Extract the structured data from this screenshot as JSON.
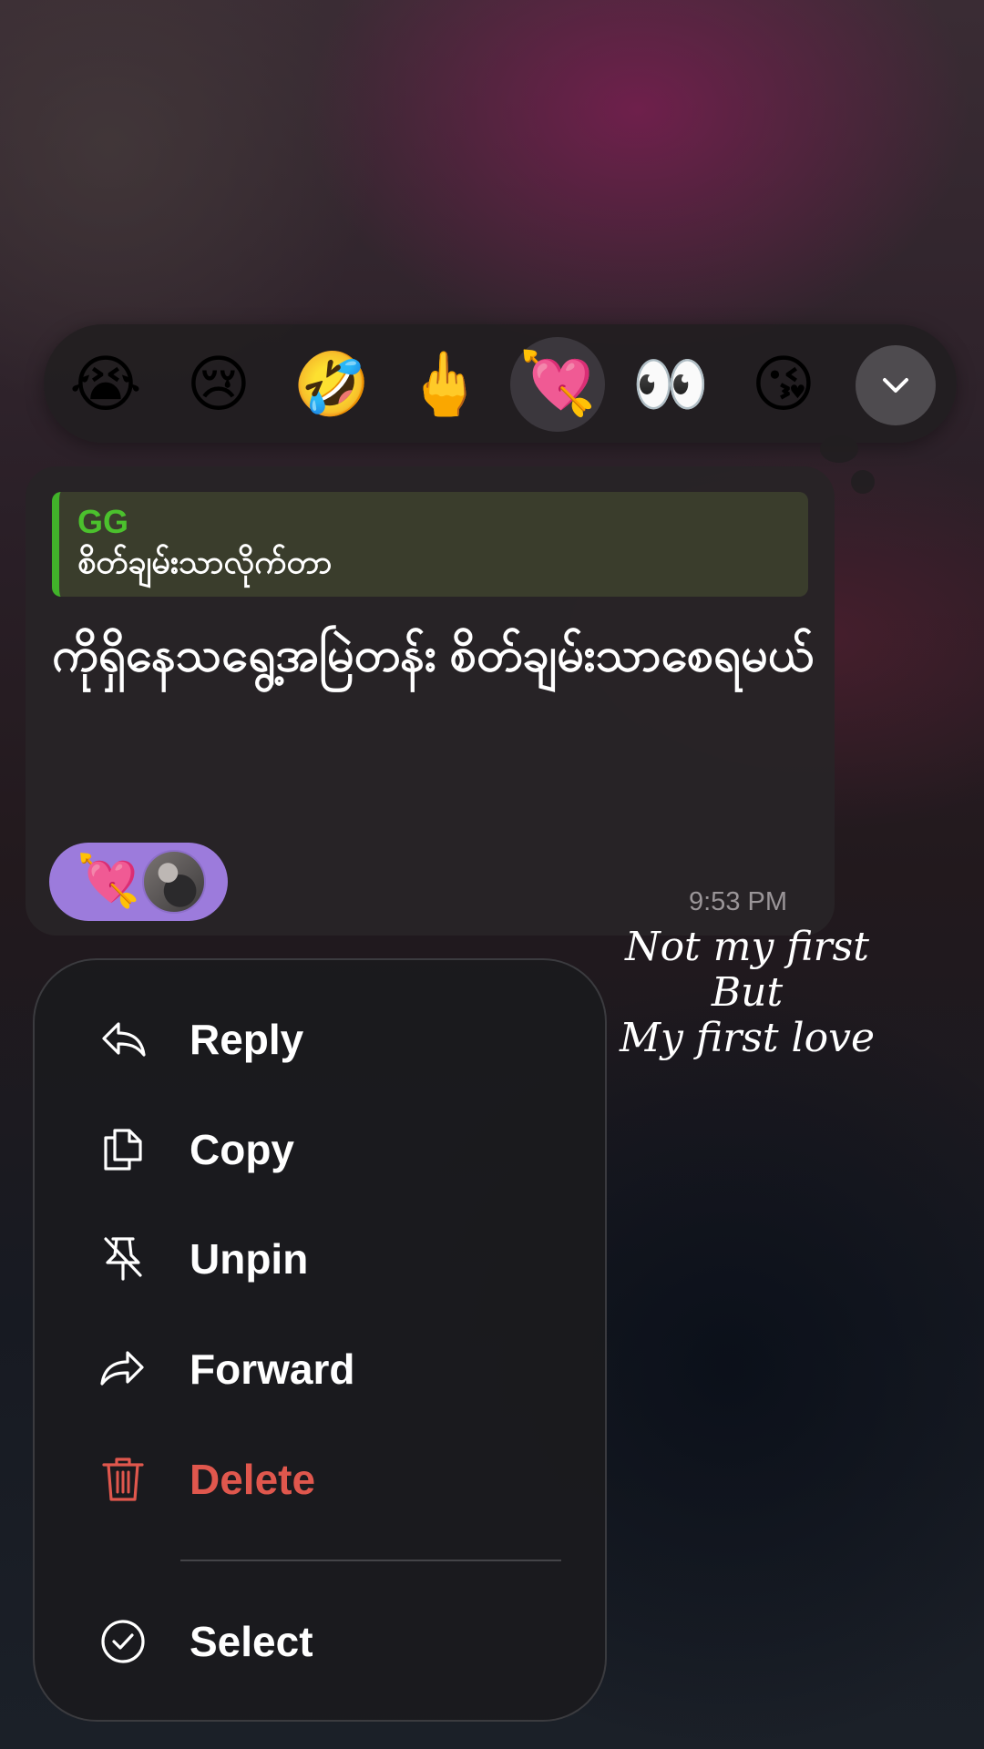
{
  "reactions": [
    {
      "emoji": "😭",
      "name": "loudly-crying-face"
    },
    {
      "emoji": "😢",
      "name": "crying-face"
    },
    {
      "emoji": "🤣",
      "name": "rolling-on-floor-laughing"
    },
    {
      "emoji": "🖕",
      "name": "middle-finger"
    },
    {
      "emoji": "💘",
      "name": "heart-with-arrow"
    },
    {
      "emoji": "👀",
      "name": "eyes"
    },
    {
      "emoji": "😘",
      "name": "face-blowing-kiss"
    }
  ],
  "selected_reaction": "heart-with-arrow",
  "expand_icon": "chevron-down-icon",
  "message": {
    "quote": {
      "sender": "GG",
      "text": "စိတ်ချမ်းသာလိုက်တာ",
      "accent_color": "#41b22a"
    },
    "text": "ကိုရှိနေသရွေ့အမြဲတန်း စိတ်ချမ်းသာစေရမယ်",
    "time": "9:53 PM",
    "reaction_chip": {
      "emoji": "💘",
      "color": "#9c7bdc"
    }
  },
  "overlay_text": {
    "line1": "Not my first",
    "line2": "But",
    "line3": "My first love"
  },
  "menu": {
    "reply": "Reply",
    "copy": "Copy",
    "unpin": "Unpin",
    "forward": "Forward",
    "delete": "Delete",
    "select": "Select",
    "danger_color": "#e0574d"
  }
}
